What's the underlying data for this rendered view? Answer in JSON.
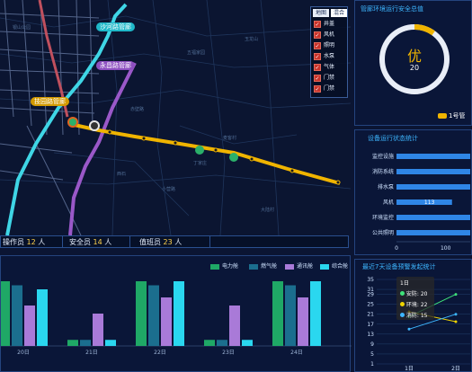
{
  "map": {
    "labels": [
      "银山公园",
      "五福家园",
      "玉龙山",
      "赤壁路",
      "麦客村",
      "丁家庄",
      "小营路",
      "大陆村",
      "西石"
    ],
    "road_tags": [
      "沙河路管廊",
      "永昌路管廊",
      "技园路管廊"
    ]
  },
  "legend": {
    "tabs": [
      "地图",
      "混合"
    ],
    "items": [
      "井盖",
      "风机",
      "照明",
      "水泵",
      "气体",
      "门禁",
      "门禁"
    ]
  },
  "staff": {
    "operators_label": "操作员",
    "operators": "12",
    "safety_label": "安全员",
    "safety": "14",
    "duty_label": "值班员",
    "duty": "23",
    "unit": "人"
  },
  "env": {
    "title": "管廊环境运行安全总值",
    "grade": "优",
    "score": "20",
    "legend": "1号管",
    "progress": 0.1
  },
  "equip": {
    "title": "设备运行状态统计"
  },
  "inspect": {
    "title": "最近7天设备预警发起统计",
    "tooltip": {
      "title": "1日",
      "rows": [
        "安防: 20",
        "环境: 22",
        "消防: 15"
      ]
    }
  },
  "bars": {
    "series_names": [
      "电力舱",
      "燃气舱",
      "通讯舱",
      "综合舱"
    ]
  },
  "colors": {
    "accent": "#3db6ff",
    "yellow": "#f0b400",
    "power": "#1fa866",
    "gas": "#1b6e8e",
    "comm": "#a97ad8",
    "total": "#2ad7ef"
  },
  "chart_data": [
    {
      "type": "bar",
      "orientation": "horizontal",
      "categories": [
        "监控设施",
        "消防系统",
        "排水泵",
        "风机",
        "环境监控",
        "公共照明"
      ],
      "values": [
        150,
        150,
        150,
        113,
        150,
        150
      ],
      "data_labels": [
        "",
        "",
        "",
        "113",
        "",
        ""
      ],
      "xlim": [
        0,
        150
      ],
      "xticks": [
        "0",
        "100"
      ]
    },
    {
      "type": "line",
      "x": [
        "1日",
        "2日"
      ],
      "yticks": [
        1,
        5,
        9,
        13,
        17,
        21,
        25,
        29,
        31,
        35
      ],
      "ylim": [
        1,
        35
      ],
      "series": [
        {
          "name": "安防",
          "values": [
            20,
            29
          ],
          "color": "#3fe37a"
        },
        {
          "name": "环境",
          "values": [
            22,
            18
          ],
          "color": "#f0d400"
        },
        {
          "name": "消防",
          "values": [
            15,
            21
          ],
          "color": "#3db6ff"
        }
      ]
    },
    {
      "type": "bar",
      "categories": [
        "20日",
        "21日",
        "22日",
        "23日",
        "24日"
      ],
      "series": [
        {
          "name": "电力舱",
          "values": [
            32,
            3,
            32,
            3,
            32
          ]
        },
        {
          "name": "燃气舱",
          "values": [
            30,
            3,
            30,
            3,
            30
          ]
        },
        {
          "name": "通讯舱",
          "values": [
            20,
            16,
            24,
            20,
            24
          ]
        },
        {
          "name": "综合舱",
          "values": [
            28,
            3,
            32,
            3,
            32
          ]
        }
      ],
      "ylim": [
        0,
        32
      ]
    }
  ]
}
